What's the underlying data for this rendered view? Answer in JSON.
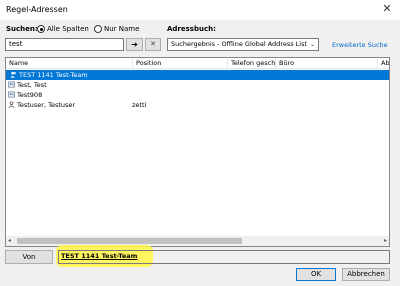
{
  "window": {
    "title": "Regel-Adressen",
    "close_glyph": "✕"
  },
  "search": {
    "label": "Suchen:",
    "radio_all": "Alle Spalten",
    "radio_name": "Nur Name",
    "selected_radio": "Alle Spalten",
    "value": "test",
    "go_glyph": "➔",
    "clear_glyph": "✕"
  },
  "addressbook": {
    "label": "Adressbuch:",
    "selected": "Suchergebnis - Offline Global Address List",
    "advanced_link": "Erweiterte Suche"
  },
  "table": {
    "columns": [
      "Name",
      "Position",
      "Telefon geschäftlich",
      "Büro",
      "Abt"
    ],
    "rows": [
      {
        "name": "TEST 1141 Test-Team",
        "position": "",
        "icon": "group-icon",
        "selected": true
      },
      {
        "name": "Test, Test",
        "position": "",
        "icon": "contact-card-icon",
        "selected": false
      },
      {
        "name": "Test908",
        "position": "",
        "icon": "contact-card-icon",
        "selected": false
      },
      {
        "name": "Testuser, Testuser",
        "position": "zetti",
        "icon": "user-icon",
        "selected": false
      }
    ]
  },
  "bottom": {
    "from_button": "Von",
    "from_value": "TEST 1141 Test-Team",
    "ok_button": "OK",
    "cancel_button": "Abbrechen"
  },
  "colors": {
    "selection": "#0078d7",
    "link": "#0066cc",
    "highlight": "#fff54f"
  }
}
